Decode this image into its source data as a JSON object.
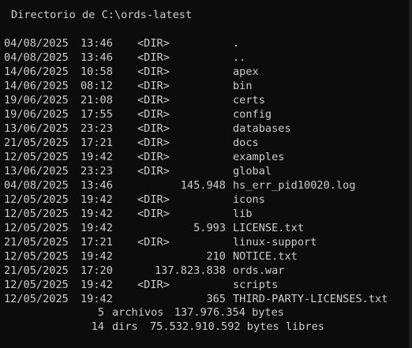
{
  "header": {
    "directory_line": "Directorio de C:\\ords-latest"
  },
  "entries": [
    {
      "date": "04/08/2025",
      "time": "13:46",
      "dir": "<DIR>",
      "size": "",
      "name": "."
    },
    {
      "date": "04/08/2025",
      "time": "13:46",
      "dir": "<DIR>",
      "size": "",
      "name": ".."
    },
    {
      "date": "14/06/2025",
      "time": "10:58",
      "dir": "<DIR>",
      "size": "",
      "name": "apex"
    },
    {
      "date": "14/06/2025",
      "time": "08:12",
      "dir": "<DIR>",
      "size": "",
      "name": "bin"
    },
    {
      "date": "19/06/2025",
      "time": "21:08",
      "dir": "<DIR>",
      "size": "",
      "name": "certs"
    },
    {
      "date": "19/06/2025",
      "time": "17:55",
      "dir": "<DIR>",
      "size": "",
      "name": "config"
    },
    {
      "date": "13/06/2025",
      "time": "23:23",
      "dir": "<DIR>",
      "size": "",
      "name": "databases"
    },
    {
      "date": "21/05/2025",
      "time": "17:21",
      "dir": "<DIR>",
      "size": "",
      "name": "docs"
    },
    {
      "date": "12/05/2025",
      "time": "19:42",
      "dir": "<DIR>",
      "size": "",
      "name": "examples"
    },
    {
      "date": "13/06/2025",
      "time": "23:23",
      "dir": "<DIR>",
      "size": "",
      "name": "global"
    },
    {
      "date": "04/08/2025",
      "time": "13:46",
      "dir": "",
      "size": "145.948",
      "name": "hs_err_pid10020.log"
    },
    {
      "date": "12/05/2025",
      "time": "19:42",
      "dir": "<DIR>",
      "size": "",
      "name": "icons"
    },
    {
      "date": "12/05/2025",
      "time": "19:42",
      "dir": "<DIR>",
      "size": "",
      "name": "lib"
    },
    {
      "date": "12/05/2025",
      "time": "19:42",
      "dir": "",
      "size": "5.993",
      "name": "LICENSE.txt"
    },
    {
      "date": "21/05/2025",
      "time": "17:21",
      "dir": "<DIR>",
      "size": "",
      "name": "linux-support"
    },
    {
      "date": "12/05/2025",
      "time": "19:42",
      "dir": "",
      "size": "210",
      "name": "NOTICE.txt"
    },
    {
      "date": "21/05/2025",
      "time": "17:20",
      "dir": "",
      "size": "137.823.838",
      "name": "ords.war"
    },
    {
      "date": "12/05/2025",
      "time": "19:42",
      "dir": "<DIR>",
      "size": "",
      "name": "scripts"
    },
    {
      "date": "12/05/2025",
      "time": "19:42",
      "dir": "",
      "size": "365",
      "name": "THIRD-PARTY-LICENSES.txt"
    }
  ],
  "summary": {
    "files_count": "5",
    "files_label": "archivos",
    "files_bytes": "137.976.354 bytes",
    "dirs_count": "14",
    "dirs_label": "dirs",
    "dirs_bytes": "75.532.910.592 bytes libres"
  }
}
